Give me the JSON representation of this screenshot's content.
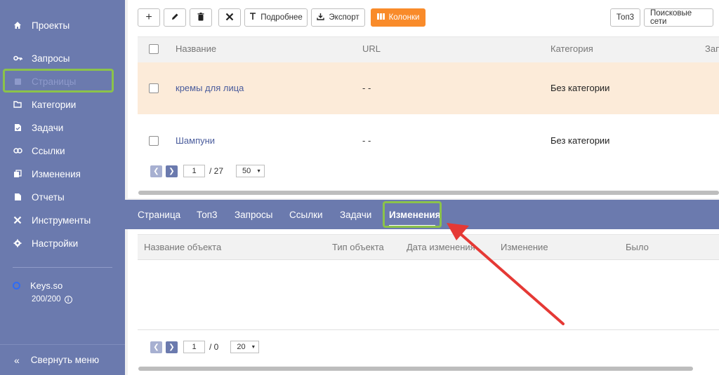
{
  "sidebar": {
    "items": [
      {
        "label": "Проекты",
        "icon": "home-icon"
      },
      {
        "label": "Запросы",
        "icon": "key-icon"
      },
      {
        "label": "Страницы",
        "icon": "page-icon"
      },
      {
        "label": "Категории",
        "icon": "folder-icon"
      },
      {
        "label": "Задачи",
        "icon": "task-icon"
      },
      {
        "label": "Ссылки",
        "icon": "link-icon"
      },
      {
        "label": "Изменения",
        "icon": "changes-icon"
      },
      {
        "label": "Отчеты",
        "icon": "report-icon"
      },
      {
        "label": "Инструменты",
        "icon": "tools-icon"
      },
      {
        "label": "Настройки",
        "icon": "gear-icon"
      }
    ],
    "account": {
      "name": "Keys.so",
      "quota": "200/200"
    },
    "collapse_label": "Свернуть меню"
  },
  "toolbar": {
    "add": "+",
    "details_label": "Подробнее",
    "export_label": "Экспорт",
    "columns_label": "Колонки",
    "top3_label": "Топ3",
    "search_engines_label": "Поисковые сети"
  },
  "pages_table": {
    "columns": [
      "Название",
      "URL",
      "Категория",
      "Зап"
    ],
    "rows": [
      {
        "name": "кремы для лица",
        "url": "- -",
        "category": "Без категории"
      },
      {
        "name": "Шампуни",
        "url": "- -",
        "category": "Без категории"
      }
    ],
    "pager": {
      "page": "1",
      "total": "/ 27",
      "size": "50"
    }
  },
  "tabs": [
    "Страница",
    "Топ3",
    "Запросы",
    "Ссылки",
    "Задачи",
    "Изменения"
  ],
  "changes_table": {
    "columns": [
      "Название объекта",
      "Тип объекта",
      "Дата изменения",
      "Изменение",
      "Было"
    ],
    "pager": {
      "page": "1",
      "total": "/ 0",
      "size": "20"
    }
  },
  "colors": {
    "sidebar": "#6b7aae",
    "accent_orange": "#f98b2a",
    "highlight_green": "#8bc34a",
    "annotation_arrow": "#e53935",
    "selected_row": "#fcebd9"
  }
}
